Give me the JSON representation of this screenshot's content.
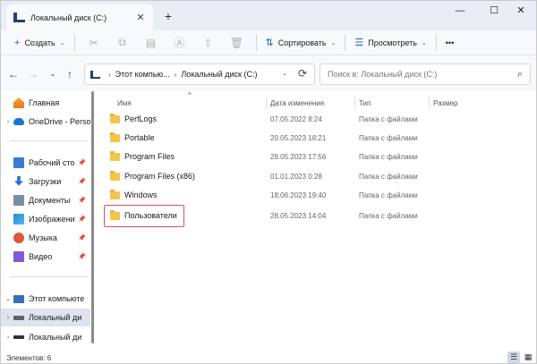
{
  "window": {
    "tab_title": "Локальный диск (C:)",
    "tab_close": "✕",
    "new_tab": "+",
    "minimize": "—",
    "maximize": "☐",
    "close": "✕"
  },
  "toolbar": {
    "create_label": "Создать",
    "create_icon": "+",
    "sort_label": "Сортировать",
    "sort_icon": "⇅",
    "view_label": "Просмотреть",
    "view_icon": "☰",
    "more": "•••",
    "chevron": "⌄",
    "icons": {
      "cut": "✂",
      "copy": "⧉",
      "paste": "▤",
      "rename": "Ⓐ",
      "share": "⇪",
      "delete": "🗑"
    }
  },
  "nav": {
    "back": "←",
    "forward": "→",
    "recent": "⌄",
    "up": "↑",
    "breadcrumb": [
      "Этот компью...",
      "Локальный диск (C:)"
    ],
    "crumb_separator": "›",
    "address_dropdown": "⌄",
    "refresh": "⟳",
    "search_placeholder": "Поиск в: Локальный диск (C:)",
    "search_icon": "⌕"
  },
  "sidebar": {
    "items": [
      {
        "label": "Главная",
        "expand": "",
        "pin": "",
        "icon": "home-icon"
      },
      {
        "label": "OneDrive - Perso",
        "expand": "›",
        "pin": "",
        "icon": "cloud-icon"
      },
      {
        "label": "Рабочий сто",
        "expand": "",
        "pin": "📌",
        "icon": "desktop-icon"
      },
      {
        "label": "Загрузки",
        "expand": "",
        "pin": "📌",
        "icon": "downloads-icon"
      },
      {
        "label": "Документы",
        "expand": "",
        "pin": "📌",
        "icon": "documents-icon"
      },
      {
        "label": "Изображени",
        "expand": "",
        "pin": "📌",
        "icon": "pictures-icon"
      },
      {
        "label": "Музыка",
        "expand": "",
        "pin": "📌",
        "icon": "music-icon"
      },
      {
        "label": "Видео",
        "expand": "",
        "pin": "📌",
        "icon": "videos-icon"
      },
      {
        "label": "Этот компьюте",
        "expand": "⌄",
        "pin": "",
        "icon": "computer-icon"
      },
      {
        "label": "Локальный ди",
        "expand": "›",
        "pin": "",
        "icon": "drive-icon",
        "selected": true
      },
      {
        "label": "Локальный ди",
        "expand": "›",
        "pin": "",
        "icon": "drive-icon"
      }
    ]
  },
  "columns": {
    "name": "Имя",
    "date": "Дата изменения",
    "type": "Тип",
    "size": "Размер",
    "sort_caret": "^"
  },
  "files": [
    {
      "name": "PerfLogs",
      "date": "07.05.2022 8:24",
      "type": "Папка с файлами"
    },
    {
      "name": "Portable",
      "date": "20.05.2023 18:21",
      "type": "Папка с файлами"
    },
    {
      "name": "Program Files",
      "date": "28.05.2023 17:56",
      "type": "Папка с файлами"
    },
    {
      "name": "Program Files (x86)",
      "date": "01.01.2023 0:28",
      "type": "Папка с файлами"
    },
    {
      "name": "Windows",
      "date": "18.06.2023 19:40",
      "type": "Папка с файлами"
    },
    {
      "name": "Пользователи",
      "date": "28.05.2023 14:04",
      "type": "Папка с файлами"
    }
  ],
  "status": {
    "items_count": "Элементов: 6",
    "details_view": "☰",
    "tiles_view": "▦"
  },
  "colors": {
    "accent": "#2b62b5",
    "highlight": "#d9534f",
    "folder": "#f4c54b"
  }
}
